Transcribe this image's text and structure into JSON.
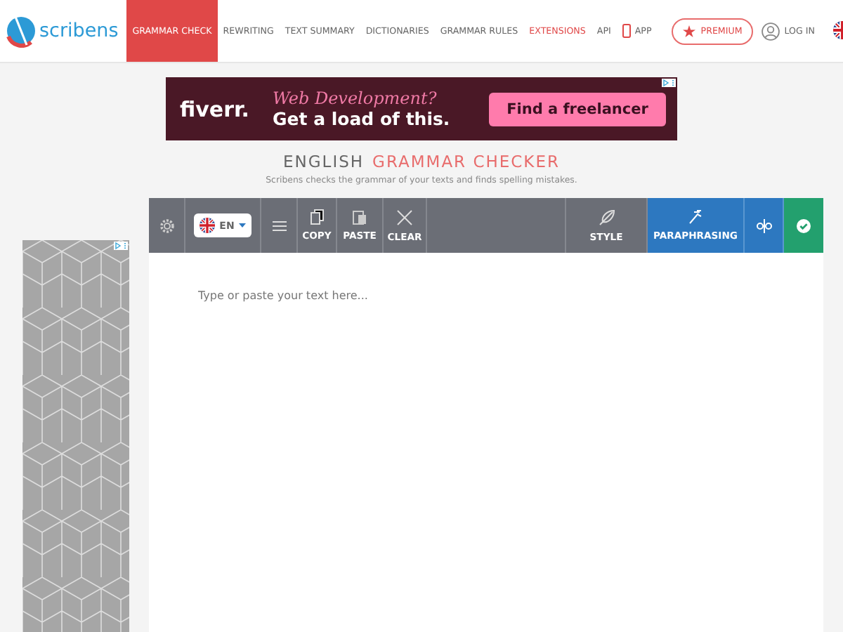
{
  "header": {
    "logo": "scribens",
    "nav": [
      {
        "label": "GRAMMAR CHECK",
        "selected": true,
        "kind": "link"
      },
      {
        "label": "REWRITING",
        "selected": false,
        "kind": "link"
      },
      {
        "label": "TEXT SUMMARY",
        "selected": false,
        "kind": "link"
      },
      {
        "label": "DICTIONARIES",
        "selected": false,
        "kind": "link"
      },
      {
        "label": "GRAMMAR RULES",
        "selected": false,
        "kind": "link"
      },
      {
        "label": "EXTENSIONS",
        "selected": false,
        "kind": "accent"
      },
      {
        "label": "API",
        "selected": false,
        "kind": "link"
      },
      {
        "label": "APP",
        "selected": false,
        "kind": "app"
      }
    ],
    "premium": "PREMIUM",
    "login": "LOG IN"
  },
  "ad": {
    "brand": "fiverr.",
    "headline": "Web Development?",
    "tagline": "Get a load of this.",
    "button": "Find a freelancer"
  },
  "heading": {
    "main": "ENGLISH",
    "accent": "GRAMMAR CHECKER",
    "subtitle": "Scribens checks the grammar of your texts and finds spelling mistakes."
  },
  "toolbar": {
    "language": "EN",
    "tools": [
      {
        "kind": "gear"
      },
      {
        "kind": "lang"
      },
      {
        "kind": "menu"
      },
      {
        "kind": "copy",
        "label": "COPY"
      },
      {
        "kind": "paste",
        "label": "PASTE"
      },
      {
        "kind": "clear",
        "label": "CLEAR"
      },
      {
        "kind": "spacer"
      },
      {
        "kind": "style",
        "label": "STYLE"
      },
      {
        "kind": "paraphrase",
        "label": "PARAPHRASING"
      },
      {
        "kind": "split"
      },
      {
        "kind": "check"
      }
    ]
  },
  "editor": {
    "placeholder": "Type or paste your text here..."
  }
}
